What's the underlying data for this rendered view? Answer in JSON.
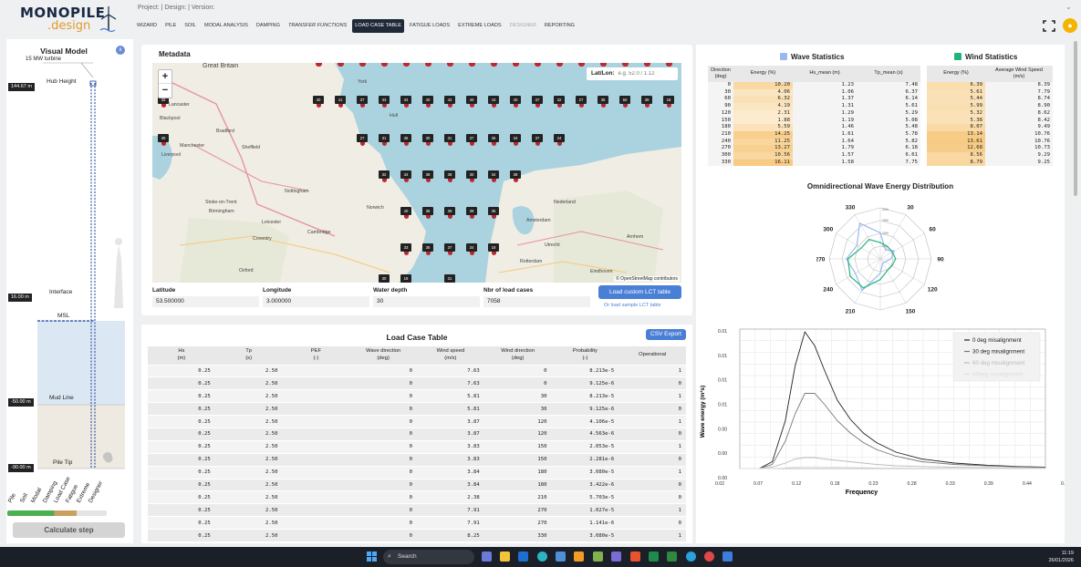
{
  "header": {
    "logo_top": "MONOPILE",
    "logo_bottom": ".design",
    "project_line": "Project: | Design: | Version:"
  },
  "tabs": [
    {
      "label": "WIZARD",
      "state": ""
    },
    {
      "label": "PILE",
      "state": ""
    },
    {
      "label": "SOIL",
      "state": ""
    },
    {
      "label": "MODAL ANALYSIS",
      "state": ""
    },
    {
      "label": "DAMPING",
      "state": ""
    },
    {
      "label": "TRANSFER FUNCTIONS",
      "state": "italic"
    },
    {
      "label": "LOAD CASE TABLE",
      "state": "active"
    },
    {
      "label": "FATIGUE LOADS",
      "state": ""
    },
    {
      "label": "EXTREME LOADS",
      "state": ""
    },
    {
      "label": "DESIGNER",
      "state": "disabled"
    },
    {
      "label": "REPORTING",
      "state": ""
    }
  ],
  "visual_model": {
    "title": "Visual Model",
    "close": "x",
    "turbine": "15 MW turbine",
    "hub_height": "Hub Height",
    "hub_elev": "144.67 m",
    "interface": "Interface",
    "interface_elev": "16.00 m",
    "msl": "MSL",
    "mudline": "Mud Line",
    "mudline_elev": "-50.00 m",
    "piletip": "Pile Tip",
    "piletip_elev": "-90.00 m",
    "steps": [
      "Pile",
      "Soil",
      "Modal",
      "Damping",
      "Load Case",
      "Fatigue",
      "Extreme",
      "Designer"
    ],
    "progress": 0.7,
    "calc_button": "Calculate step"
  },
  "metadata": {
    "title": "Metadata",
    "latlon_label": "Lat/Lon:",
    "latlon_placeholder": "e.g. 52.0 / 1.12",
    "zoom_in": "+",
    "zoom_out": "−",
    "attribution": "© OpenStreetMap contributors",
    "fields": {
      "latitude": {
        "label": "Latitude",
        "value": "53.500000"
      },
      "longitude": {
        "label": "Longitude",
        "value": "3.000000"
      },
      "water_depth": {
        "label": "Water depth",
        "value": "30"
      },
      "nbr_cases": {
        "label": "Nbr of load cases",
        "value": "7058"
      }
    },
    "load_custom": "Load custom LCT table",
    "load_sample": "Or load sample LCT table",
    "places": [
      {
        "name": "Great Britain"
      },
      {
        "name": "Lancaster"
      },
      {
        "name": "York"
      },
      {
        "name": "Hull"
      },
      {
        "name": "Blackpool"
      },
      {
        "name": "Bradford"
      },
      {
        "name": "Manchester"
      },
      {
        "name": "Sheffield"
      },
      {
        "name": "Liverpool"
      },
      {
        "name": "Stoke-on-Trent"
      },
      {
        "name": "Nottingham"
      },
      {
        "name": "Leicester"
      },
      {
        "name": "Birmingham"
      },
      {
        "name": "Coventry"
      },
      {
        "name": "Norwich"
      },
      {
        "name": "Cambridge"
      },
      {
        "name": "Oxford"
      },
      {
        "name": "Amsterdam"
      },
      {
        "name": "Nederland"
      },
      {
        "name": "Utrecht"
      },
      {
        "name": "Arnhem"
      },
      {
        "name": "Rotterdam"
      },
      {
        "name": "Eindhoven"
      }
    ],
    "markers": [
      "32",
      "40",
      "41",
      "37",
      "33",
      "34",
      "40",
      "42",
      "40",
      "43",
      "40",
      "37",
      "32",
      "27",
      "35",
      "50",
      "39",
      "18",
      "30",
      "27",
      "31",
      "35",
      "30",
      "31",
      "37",
      "35",
      "34",
      "37",
      "24",
      "32",
      "34",
      "38",
      "38",
      "30",
      "34",
      "38",
      "40",
      "38",
      "39",
      "39",
      "35",
      "33",
      "35",
      "37",
      "34",
      "18",
      "30",
      "18",
      "31"
    ]
  },
  "lct": {
    "title": "Load Case Table",
    "csv": "CSV Export",
    "headers": [
      [
        "Hs",
        "(m)"
      ],
      [
        "Tp",
        "(s)"
      ],
      [
        "PEF",
        "(-)"
      ],
      [
        "Wave direction",
        "(deg)"
      ],
      [
        "Wind speed",
        "(m/s)"
      ],
      [
        "Wind direction",
        "(deg)"
      ],
      [
        "Probability",
        "(-)"
      ],
      [
        "Operational",
        ""
      ]
    ],
    "rows": [
      [
        "0.25",
        "2.50",
        "",
        "0",
        "7.63",
        "0",
        "8.213e-5",
        "1"
      ],
      [
        "0.25",
        "2.50",
        "",
        "0",
        "7.63",
        "0",
        "9.125e-6",
        "0"
      ],
      [
        "0.25",
        "2.50",
        "",
        "0",
        "5.81",
        "30",
        "8.213e-5",
        "1"
      ],
      [
        "0.25",
        "2.50",
        "",
        "0",
        "5.81",
        "30",
        "9.125e-6",
        "0"
      ],
      [
        "0.25",
        "2.50",
        "",
        "0",
        "3.87",
        "120",
        "4.106e-5",
        "1"
      ],
      [
        "0.25",
        "2.50",
        "",
        "0",
        "3.87",
        "120",
        "4.563e-6",
        "0"
      ],
      [
        "0.25",
        "2.50",
        "",
        "0",
        "3.83",
        "150",
        "2.053e-5",
        "1"
      ],
      [
        "0.25",
        "2.50",
        "",
        "0",
        "3.83",
        "150",
        "2.281e-6",
        "0"
      ],
      [
        "0.25",
        "2.50",
        "",
        "0",
        "3.84",
        "180",
        "3.080e-5",
        "1"
      ],
      [
        "0.25",
        "2.50",
        "",
        "0",
        "3.84",
        "180",
        "3.422e-6",
        "0"
      ],
      [
        "0.25",
        "2.50",
        "",
        "0",
        "2.38",
        "210",
        "5.703e-5",
        "0"
      ],
      [
        "0.25",
        "2.50",
        "",
        "0",
        "7.91",
        "270",
        "1.027e-5",
        "1"
      ],
      [
        "0.25",
        "2.50",
        "",
        "0",
        "7.91",
        "270",
        "1.141e-6",
        "0"
      ],
      [
        "0.25",
        "2.50",
        "",
        "0",
        "8.25",
        "330",
        "3.080e-5",
        "1"
      ]
    ]
  },
  "wave_stats": {
    "title": "Wave Statistics",
    "color": "#9ab8f0",
    "headers": [
      [
        "Direction",
        "(deg)"
      ],
      [
        "Energy (%)",
        ""
      ],
      [
        "Hs_mean (m)",
        ""
      ],
      [
        "Tp_mean (s)",
        ""
      ]
    ],
    "rows": [
      [
        "0",
        "10.20",
        "1.23",
        "7.48"
      ],
      [
        "30",
        "4.06",
        "1.06",
        "6.37"
      ],
      [
        "60",
        "6.32",
        "1.37",
        "6.14"
      ],
      [
        "90",
        "4.19",
        "1.31",
        "5.61"
      ],
      [
        "120",
        "2.31",
        "1.29",
        "5.29"
      ],
      [
        "150",
        "1.88",
        "1.19",
        "5.08"
      ],
      [
        "180",
        "5.59",
        "1.46",
        "5.48"
      ],
      [
        "210",
        "14.25",
        "1.61",
        "5.78"
      ],
      [
        "240",
        "11.25",
        "1.64",
        "5.82"
      ],
      [
        "270",
        "13.27",
        "1.79",
        "6.18"
      ],
      [
        "300",
        "10.56",
        "1.57",
        "6.61"
      ],
      [
        "330",
        "16.11",
        "1.58",
        "7.75"
      ]
    ]
  },
  "wind_stats": {
    "title": "Wind Statistics",
    "color": "#22b37a",
    "headers": [
      [
        "Energy (%)",
        ""
      ],
      [
        "Average Wind Speed",
        "(m/s)"
      ]
    ],
    "rows": [
      [
        "6.39",
        "8.39"
      ],
      [
        "5.61",
        "7.79"
      ],
      [
        "5.44",
        "8.74"
      ],
      [
        "5.99",
        "8.90"
      ],
      [
        "5.32",
        "8.62"
      ],
      [
        "5.38",
        "8.42"
      ],
      [
        "8.07",
        "9.49"
      ],
      [
        "13.14",
        "10.76"
      ],
      [
        "13.61",
        "10.76"
      ],
      [
        "12.68",
        "10.73"
      ],
      [
        "8.56",
        "9.29"
      ],
      [
        "8.79",
        "9.25"
      ]
    ]
  },
  "polar": {
    "title": "Omnidirectional Wave Energy Distribution",
    "angle_labels": [
      "330",
      "30",
      "60",
      "90",
      "120",
      "150",
      "210",
      "240",
      "270",
      "300"
    ],
    "ring_labels": [
      "5%",
      "10%",
      "15%",
      "20%"
    ]
  },
  "chart_data": {
    "type": "line",
    "title": "",
    "xlabel": "Frequency",
    "ylabel": "Wave energy (m²s)",
    "x_ticks": [
      "0.02",
      "0.07",
      "0.12",
      "0.18",
      "0.23",
      "0.28",
      "0.33",
      "0.39",
      "0.44",
      "0.49"
    ],
    "y_ticks": [
      "0.01",
      "0.01",
      "0.01",
      "0.01",
      "0.00",
      "0.00",
      "0.00"
    ],
    "xlim": [
      0.02,
      0.49
    ],
    "ylim": [
      0,
      1
    ],
    "grid": true,
    "legend_position": "top-right",
    "series": [
      {
        "name": "0 deg misalignment",
        "color": "#222222",
        "x": [
          0.02,
          0.05,
          0.07,
          0.09,
          0.105,
          0.12,
          0.135,
          0.15,
          0.17,
          0.19,
          0.21,
          0.23,
          0.26,
          0.3,
          0.35,
          0.4,
          0.45,
          0.49
        ],
        "y": [
          0,
          0,
          0.05,
          0.35,
          0.75,
          1.0,
          0.9,
          0.72,
          0.5,
          0.36,
          0.26,
          0.19,
          0.12,
          0.07,
          0.04,
          0.025,
          0.015,
          0.01
        ]
      },
      {
        "name": "30 deg misalignment",
        "color": "#777777",
        "x": [
          0.02,
          0.05,
          0.07,
          0.09,
          0.105,
          0.12,
          0.135,
          0.15,
          0.17,
          0.19,
          0.21,
          0.23,
          0.26,
          0.3,
          0.35,
          0.4,
          0.45,
          0.49
        ],
        "y": [
          0,
          0,
          0.03,
          0.2,
          0.4,
          0.55,
          0.55,
          0.47,
          0.35,
          0.26,
          0.19,
          0.14,
          0.09,
          0.05,
          0.03,
          0.02,
          0.012,
          0.008
        ]
      },
      {
        "name": "60 deg misalignment",
        "color": "#bbbbbb",
        "x": [
          0.02,
          0.05,
          0.07,
          0.09,
          0.105,
          0.12,
          0.135,
          0.15,
          0.17,
          0.19,
          0.21,
          0.23,
          0.26,
          0.3,
          0.35,
          0.4,
          0.45,
          0.49
        ],
        "y": [
          0,
          0,
          0.01,
          0.04,
          0.07,
          0.08,
          0.08,
          0.07,
          0.06,
          0.05,
          0.04,
          0.03,
          0.02,
          0.015,
          0.01,
          0.007,
          0.005,
          0.003
        ]
      },
      {
        "name": "90deg misalignment",
        "color": "#dddddd",
        "x": [
          0.02,
          0.05,
          0.07,
          0.09,
          0.105,
          0.12,
          0.135,
          0.15,
          0.17,
          0.19,
          0.21,
          0.23,
          0.26,
          0.3,
          0.35,
          0.4,
          0.45,
          0.49
        ],
        "y": [
          0,
          0,
          0,
          0.005,
          0.01,
          0.012,
          0.012,
          0.011,
          0.01,
          0.008,
          0.006,
          0.005,
          0.004,
          0.003,
          0.002,
          0.001,
          0.001,
          0
        ]
      }
    ]
  },
  "taskbar": {
    "search": "Search",
    "time": "11:19",
    "date": "26/01/2026"
  }
}
